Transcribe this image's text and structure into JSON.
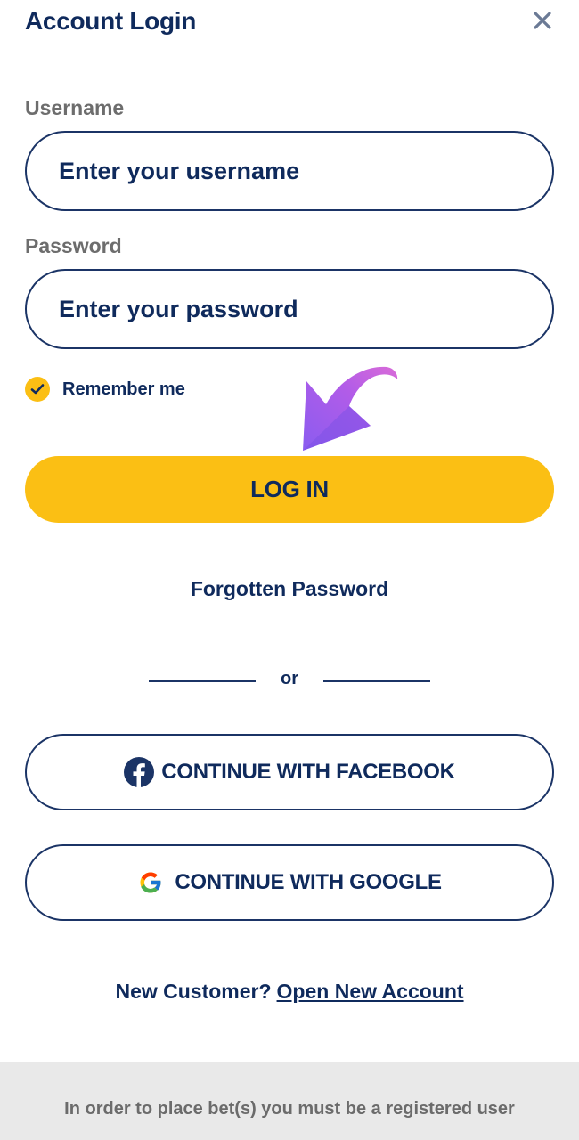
{
  "header": {
    "title": "Account Login",
    "close_icon": "close-icon"
  },
  "form": {
    "username_label": "Username",
    "username_placeholder": "Enter your username",
    "username_value": "",
    "password_label": "Password",
    "password_placeholder": "Enter your password",
    "password_value": "",
    "remember_label": "Remember me",
    "remember_checked": true,
    "login_label": "LOG IN",
    "forgot_label": "Forgotten Password"
  },
  "divider": {
    "text": "or"
  },
  "social": {
    "facebook_label": "CONTINUE WITH FACEBOOK",
    "facebook_icon": "facebook-icon",
    "google_label": "CONTINUE WITH GOOGLE",
    "google_icon": "google-icon"
  },
  "signup": {
    "prompt": "New Customer?",
    "link_label": "Open New Account"
  },
  "footer": {
    "text": "In order to place bet(s) you must be a registered user"
  },
  "colors": {
    "brand_navy": "#0f2a5c",
    "accent_yellow": "#fbbf14",
    "annotation_arrow": "#a25ef0"
  }
}
